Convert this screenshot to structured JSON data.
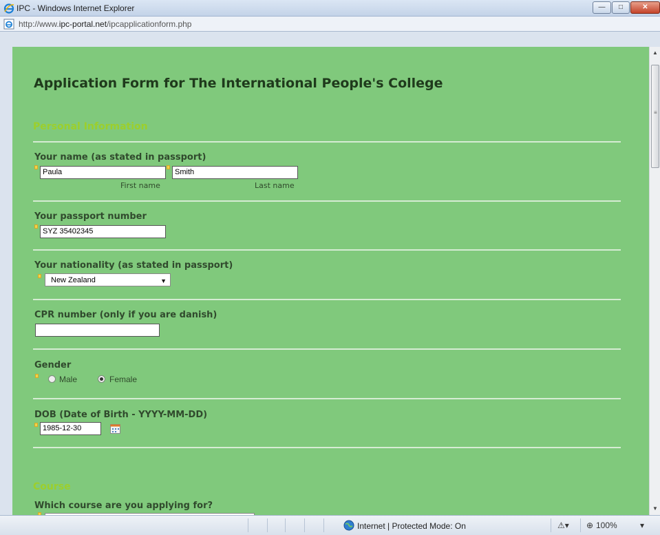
{
  "window": {
    "title": "IPC - Windows Internet Explorer",
    "url_prefix": "http://www.",
    "url_domain": "ipc-portal.net",
    "url_path": "/ipcapplicationform.php"
  },
  "form": {
    "heading": "Application Form for The International People's College",
    "personal_section": "Personal Information",
    "name_label": "Your name (as stated in passport)",
    "first_name_value": "Paula",
    "last_name_value": "Smith",
    "first_name_sublabel": "First name",
    "last_name_sublabel": "Last name",
    "passport_label": "Your passport number",
    "passport_value": "SYZ 35402345",
    "nationality_label": "Your nationality (as stated in passport)",
    "nationality_value": "New Zealand",
    "cpr_label": "CPR number (only if you are danish)",
    "cpr_value": "",
    "gender_label": "Gender",
    "gender_male": "Male",
    "gender_female": "Female",
    "gender_selected": "Female",
    "dob_label": "DOB (Date of Birth - YYYY-MM-DD)",
    "dob_value": "1985-12-30",
    "course_section": "Course",
    "course_label": "Which course are you applying for?"
  },
  "statusbar": {
    "zone": "Internet | Protected Mode: On",
    "zoom": "100%"
  },
  "colors": {
    "page_background": "#80c97c",
    "section_title": "#9ccf2c",
    "label": "#304a2d"
  }
}
